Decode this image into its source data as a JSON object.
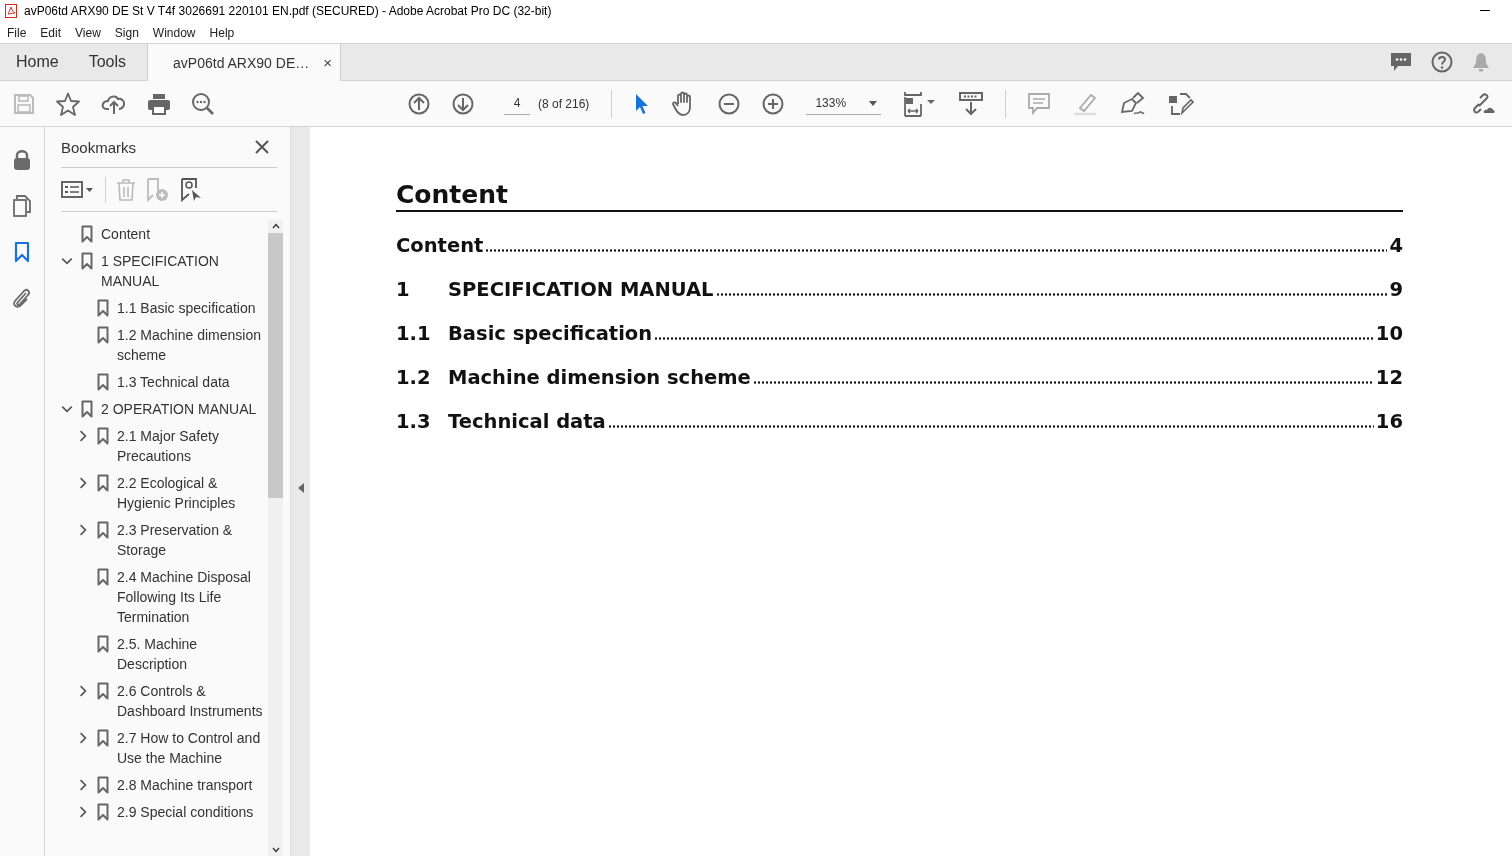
{
  "window": {
    "title": "avP06td ARX90 DE St V T4f 3026691 220101 EN.pdf (SECURED) - Adobe Acrobat Pro DC (32-bit)"
  },
  "menu": [
    "File",
    "Edit",
    "View",
    "Sign",
    "Window",
    "Help"
  ],
  "tabs": [
    {
      "label": "Home",
      "selected": false
    },
    {
      "label": "Tools",
      "selected": false
    },
    {
      "label": "avP06td ARX90 DE…",
      "selected": true,
      "close": "×"
    }
  ],
  "toolbar": {
    "page": "4",
    "page_count": "(8 of 216)",
    "zoom": "133%"
  },
  "left_rail": [
    {
      "kind": "lock",
      "selected": false
    },
    {
      "kind": "pages",
      "selected": false
    },
    {
      "kind": "bookmarks",
      "selected": true
    },
    {
      "kind": "attachments",
      "selected": false
    }
  ],
  "bookmarks": {
    "title": "Bookmarks",
    "items": [
      {
        "label": "Content"
      },
      {
        "label": "1 SPECIFICATION MANUAL",
        "expanded": true,
        "children": [
          {
            "label": "1.1 Basic specification"
          },
          {
            "label": "1.2 Machine dimension scheme"
          },
          {
            "label": "1.3 Technical data"
          }
        ]
      },
      {
        "label": "2 OPERATION MANUAL",
        "expanded": true,
        "children": [
          {
            "label": "2.1 Major Safety Precautions",
            "expanded": false
          },
          {
            "label": "2.2 Ecological & Hygienic Principles",
            "expanded": false
          },
          {
            "label": "2.3 Preservation & Storage",
            "expanded": false
          },
          {
            "label": "2.4 Machine Disposal Following Its Life Termination"
          },
          {
            "label": "2.5. Machine Description"
          },
          {
            "label": "2.6 Controls & Dashboard Instruments",
            "expanded": false
          },
          {
            "label": "2.7 How to Control and Use the Machine",
            "expanded": false
          },
          {
            "label": "2.8 Machine transport",
            "expanded": false
          },
          {
            "label": "2.9 Special conditions",
            "expanded": false
          }
        ]
      }
    ]
  },
  "document": {
    "heading": "Content",
    "toc": [
      {
        "title": "Content",
        "page": "4"
      },
      {
        "number": "1",
        "title": "SPECIFICATION MANUAL",
        "page": "9"
      },
      {
        "number": "1.1",
        "title": "Basic specification",
        "page": "10"
      },
      {
        "number": "1.2",
        "title": "Machine dimension scheme",
        "page": "12"
      },
      {
        "number": "1.3",
        "title": "Technical data",
        "page": "16"
      }
    ]
  }
}
